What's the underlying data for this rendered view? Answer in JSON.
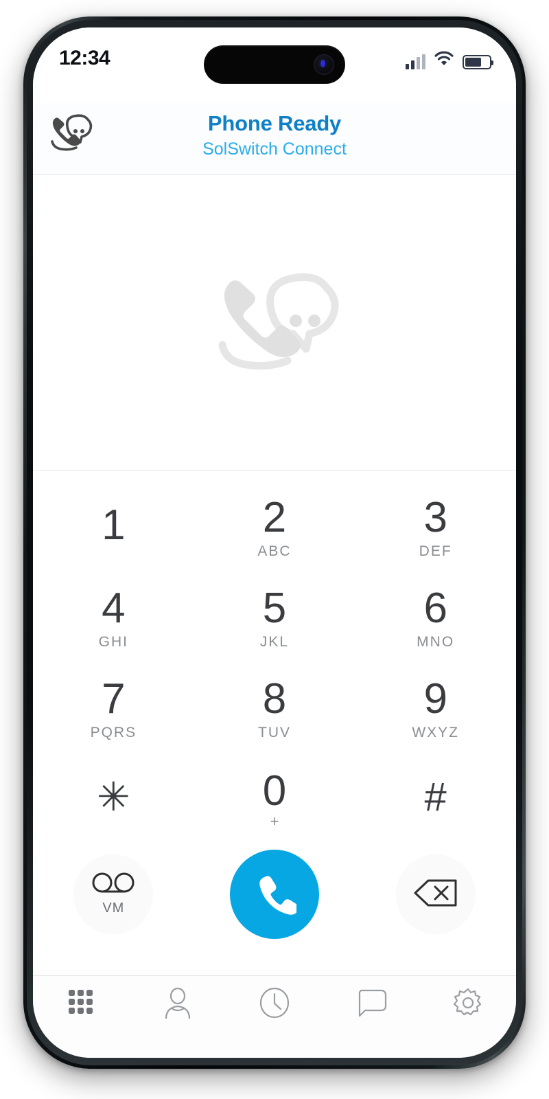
{
  "device": {
    "status_bar": {
      "time": "12:34",
      "signal_icon": "cellular-signal-icon",
      "wifi_icon": "wifi-icon",
      "battery_icon": "battery-icon",
      "battery_level_pct": 68
    },
    "dynamic_island": "dynamic-island"
  },
  "app": {
    "header": {
      "logo_icon": "phone-chat-logo-icon",
      "title": "Phone Ready",
      "subtitle": "SolSwitch Connect",
      "title_color": "#0f80c6",
      "subtitle_color": "#2badea"
    },
    "display": {
      "watermark_icon": "phone-chat-watermark-icon",
      "dialed_number": ""
    },
    "keypad": {
      "keys": [
        {
          "digit": "1",
          "letters": ""
        },
        {
          "digit": "2",
          "letters": "ABC"
        },
        {
          "digit": "3",
          "letters": "DEF"
        },
        {
          "digit": "4",
          "letters": "GHI"
        },
        {
          "digit": "5",
          "letters": "JKL"
        },
        {
          "digit": "6",
          "letters": "MNO"
        },
        {
          "digit": "7",
          "letters": "PQRS"
        },
        {
          "digit": "8",
          "letters": "TUV"
        },
        {
          "digit": "9",
          "letters": "WXYZ"
        },
        {
          "digit": "✳",
          "letters": ""
        },
        {
          "digit": "0",
          "letters": "+"
        },
        {
          "digit": "#",
          "letters": ""
        }
      ]
    },
    "actions": {
      "voicemail": {
        "icon": "voicemail-icon",
        "label": "VM"
      },
      "call": {
        "icon": "call-handset-icon",
        "color": "#06a7e2"
      },
      "delete": {
        "icon": "backspace-delete-icon"
      }
    },
    "tabs": [
      {
        "name": "keypad",
        "icon": "keypad-grid-icon",
        "active": true
      },
      {
        "name": "contacts",
        "icon": "person-icon",
        "active": false
      },
      {
        "name": "recents",
        "icon": "clock-icon",
        "active": false
      },
      {
        "name": "messages",
        "icon": "message-bubble-icon",
        "active": false
      },
      {
        "name": "settings",
        "icon": "gear-icon",
        "active": false
      }
    ]
  }
}
